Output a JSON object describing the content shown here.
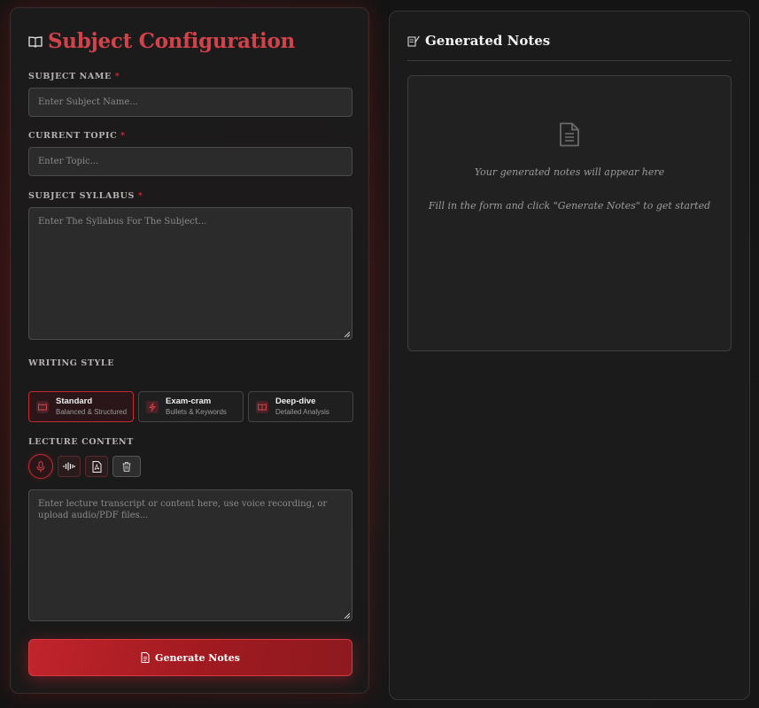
{
  "form": {
    "title": "Subject Configuration",
    "subject_name": {
      "label": "SUBJECT NAME",
      "required_mark": "*",
      "placeholder": "Enter Subject Name..."
    },
    "current_topic": {
      "label": "CURRENT TOPIC",
      "required_mark": "*",
      "placeholder": "Enter Topic..."
    },
    "syllabus": {
      "label": "SUBJECT SYLLABUS",
      "required_mark": "*",
      "placeholder": "Enter The Syllabus For The Subject..."
    },
    "writing_style": {
      "label": "WRITING STYLE",
      "selected": "Standard",
      "options": [
        {
          "title": "Standard",
          "subtitle": "Balanced & Structured",
          "icon": "book-icon"
        },
        {
          "title": "Exam-cram",
          "subtitle": "Bullets & Keywords",
          "icon": "lightning-icon"
        },
        {
          "title": "Deep-dive",
          "subtitle": "Detailed Analysis",
          "icon": "book-open-icon"
        }
      ]
    },
    "lecture_content": {
      "label": "LECTURE CONTENT",
      "tools": [
        "microphone-icon",
        "audio-wave-icon",
        "pdf-file-icon",
        "trash-icon"
      ],
      "placeholder": "Enter lecture transcript or content here, use voice recording, or upload audio/PDF files..."
    },
    "generate_button": {
      "label": "Generate Notes"
    }
  },
  "output": {
    "title": "Generated Notes",
    "empty_message": "Your generated notes will appear here",
    "empty_hint": "Fill in the form and click \"Generate Notes\" to get started"
  },
  "colors": {
    "accent": "#c52a32",
    "title_red": "#d2424a",
    "background": "#141414",
    "panel": "#1b1b1b"
  }
}
